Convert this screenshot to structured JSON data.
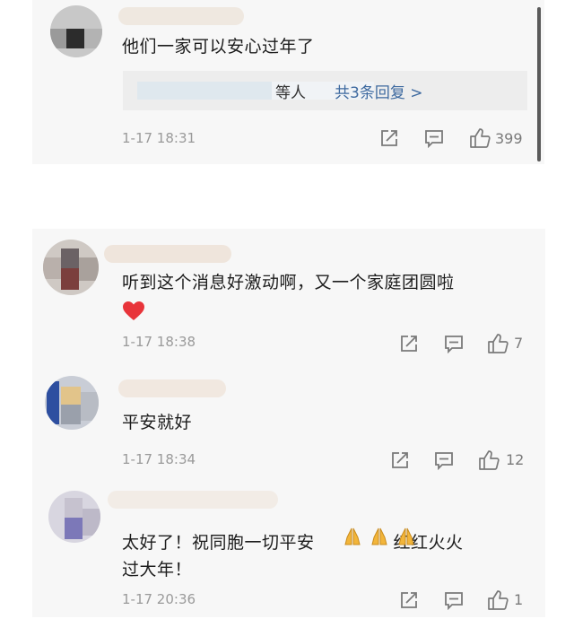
{
  "comments": [
    {
      "text": "他们一家可以安心过年了",
      "reply_suffix": "等人",
      "reply_link": "共3条回复 >",
      "time": "1-17 18:31",
      "likes": "399"
    },
    {
      "text": "听到这个消息好激动啊，又一个家庭团圆啦",
      "time": "1-17 18:38",
      "likes": "7"
    },
    {
      "text": "平安就好",
      "time": "1-17 18:34",
      "likes": "12"
    },
    {
      "text_part1": "太好了！祝同胞一切平安",
      "text_part2": "红红火火",
      "text_line2": "过大年！",
      "time": "1-17 20:36",
      "likes": "1"
    }
  ],
  "icons": [
    "share-icon",
    "comment-icon",
    "like-icon",
    "heart-emoji",
    "pray-emoji"
  ],
  "colors": {
    "card_bg": "#f7f7f7",
    "link": "#3e6aa0",
    "meta": "#9a9a9a",
    "heart": "#e8343a",
    "pray": "#f2b53a"
  }
}
